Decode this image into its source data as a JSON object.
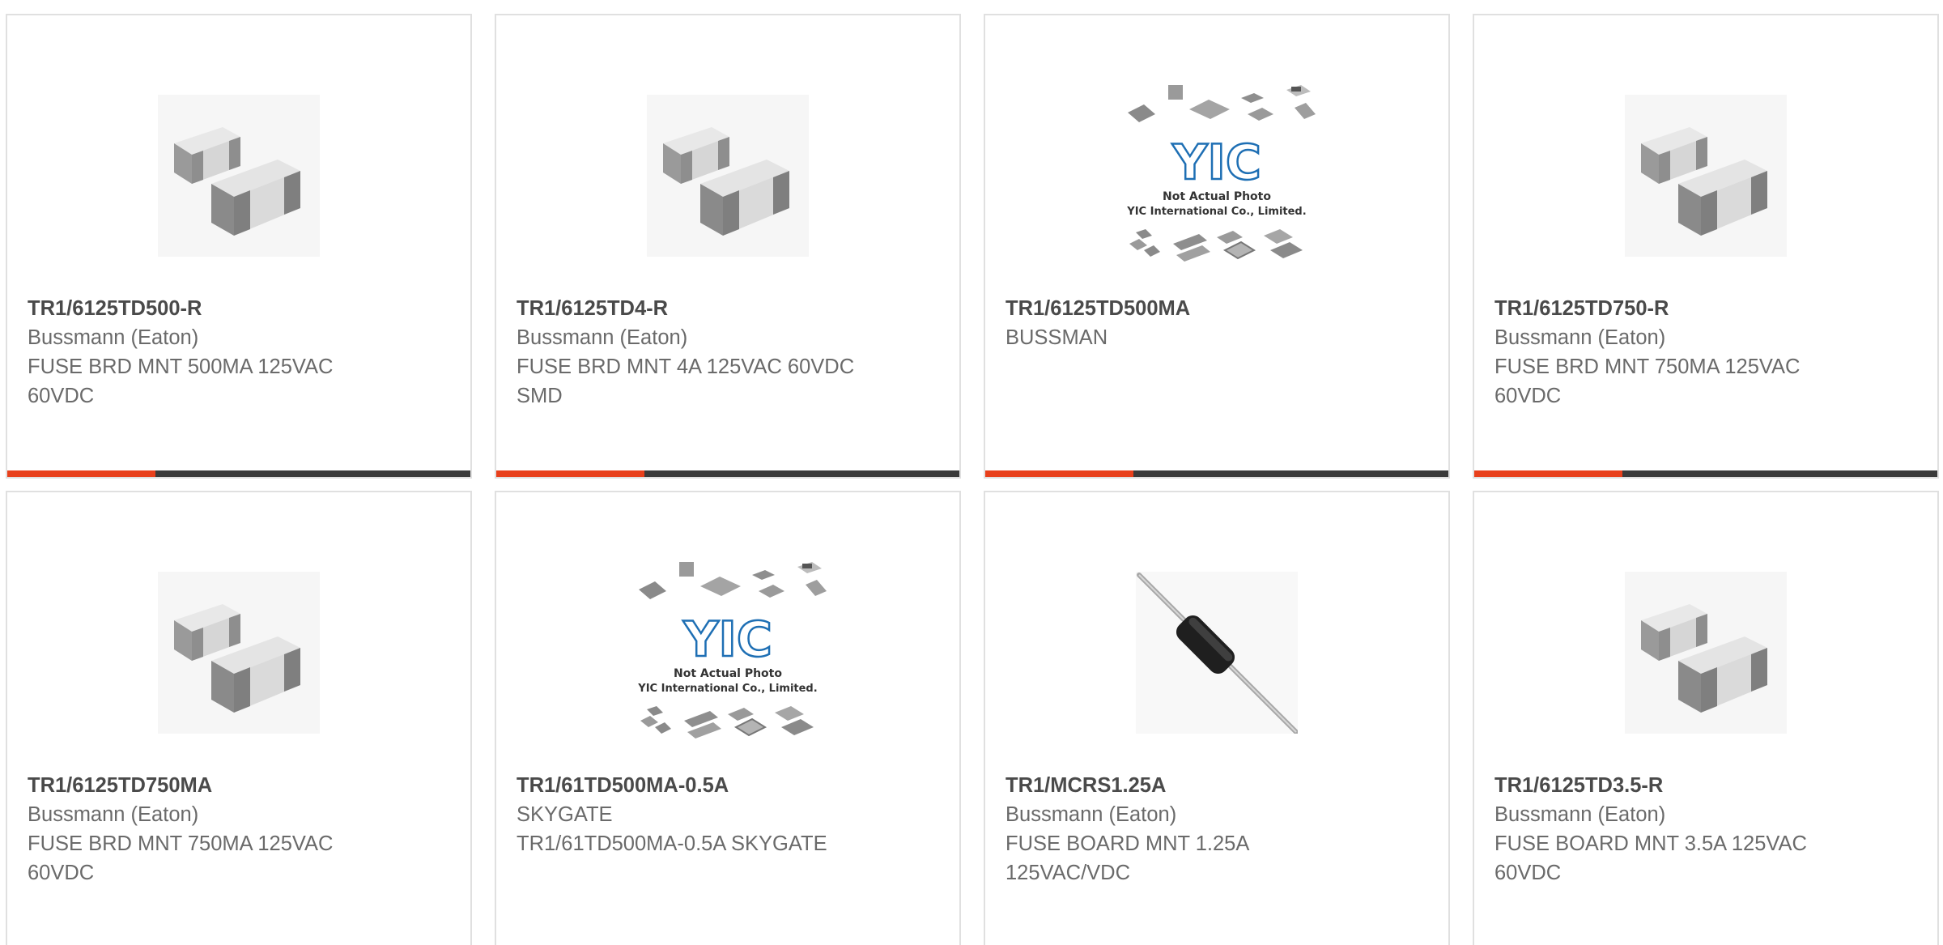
{
  "theme": {
    "accent_color": "#e8401c",
    "bar_color": "#3a3a3a"
  },
  "products": [
    {
      "part_number": "TR1/6125TD500-R",
      "manufacturer": "Bussmann (Eaton)",
      "description": "FUSE BRD MNT 500MA 125VAC 60VDC",
      "image": "smd-fuse-photo",
      "has_accent_bar": true
    },
    {
      "part_number": "TR1/6125TD4-R",
      "manufacturer": "Bussmann (Eaton)",
      "description": "FUSE BRD MNT 4A 125VAC 60VDC SMD",
      "image": "smd-fuse-photo",
      "has_accent_bar": true
    },
    {
      "part_number": "TR1/6125TD500MA",
      "manufacturer": "BUSSMAN",
      "description": "",
      "image": "placeholder-photo",
      "placeholder": {
        "logo": "YIC",
        "line1": "Not Actual Photo",
        "line2": "YIC International Co., Limited."
      },
      "has_accent_bar": true
    },
    {
      "part_number": "TR1/6125TD750-R",
      "manufacturer": "Bussmann (Eaton)",
      "description": "FUSE BRD MNT 750MA 125VAC 60VDC",
      "image": "smd-fuse-photo",
      "has_accent_bar": true
    },
    {
      "part_number": "TR1/6125TD750MA",
      "manufacturer": "Bussmann (Eaton)",
      "description": "FUSE BRD MNT 750MA 125VAC 60VDC",
      "image": "smd-fuse-photo",
      "has_accent_bar": false
    },
    {
      "part_number": "TR1/61TD500MA-0.5A",
      "manufacturer": "SKYGATE",
      "description": "TR1/61TD500MA-0.5A SKYGATE",
      "image": "placeholder-photo",
      "placeholder": {
        "logo": "YIC",
        "line1": "Not Actual Photo",
        "line2": "YIC International Co., Limited."
      },
      "has_accent_bar": false
    },
    {
      "part_number": "TR1/MCRS1.25A",
      "manufacturer": "Bussmann (Eaton)",
      "description": "FUSE BOARD MNT 1.25A 125VAC/VDC",
      "image": "axial-fuse-photo",
      "has_accent_bar": false
    },
    {
      "part_number": "TR1/6125TD3.5-R",
      "manufacturer": "Bussmann (Eaton)",
      "description": "FUSE BOARD MNT 3.5A 125VAC 60VDC",
      "image": "smd-fuse-photo",
      "has_accent_bar": false
    }
  ]
}
